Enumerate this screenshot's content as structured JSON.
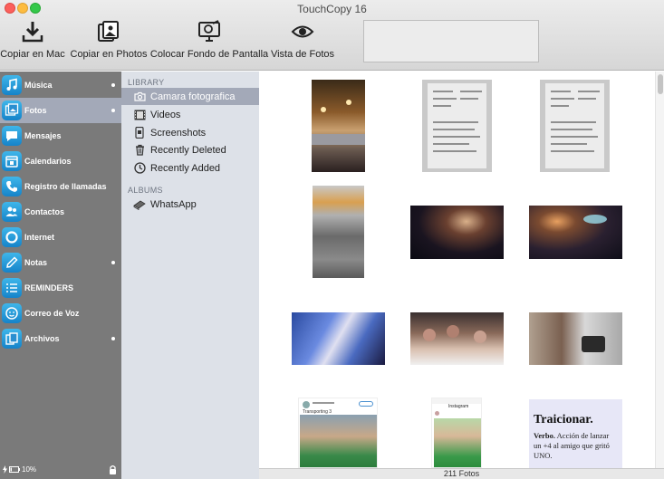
{
  "window": {
    "title": "TouchCopy 16"
  },
  "toolbar": {
    "buttons": [
      {
        "label": "Copiar en Mac",
        "icon": "download-icon"
      },
      {
        "label": "Copiar en Photos",
        "icon": "photos-stack-icon"
      },
      {
        "label": "Colocar Fondo de Pantalla",
        "icon": "monitor-wallpaper-icon"
      },
      {
        "label": "Vista de Fotos",
        "icon": "eye-icon"
      }
    ]
  },
  "sidebar": {
    "items": [
      {
        "label": "Música",
        "icon": "music-note-icon",
        "dot": true
      },
      {
        "label": "Fotos",
        "icon": "photos-icon",
        "dot": true,
        "active": true
      },
      {
        "label": "Mensajes",
        "icon": "chat-bubble-icon",
        "dot": false
      },
      {
        "label": "Calendarios",
        "icon": "calendar-icon",
        "dot": false
      },
      {
        "label": "Registro de llamadas",
        "icon": "phone-icon",
        "dot": false
      },
      {
        "label": "Contactos",
        "icon": "contacts-icon",
        "dot": false
      },
      {
        "label": "Internet",
        "icon": "internet-icon",
        "dot": false
      },
      {
        "label": "Notas",
        "icon": "pencil-icon",
        "dot": true
      },
      {
        "label": "REMINDERS",
        "icon": "list-icon",
        "dot": false
      },
      {
        "label": "Correo de Voz",
        "icon": "voicemail-icon",
        "dot": false
      },
      {
        "label": "Archivos",
        "icon": "files-icon",
        "dot": true
      }
    ],
    "battery": "10%"
  },
  "library": {
    "library_heading": "LIBRARY",
    "library_items": [
      {
        "label": "Camara fotografica",
        "icon": "camera-icon",
        "active": true
      },
      {
        "label": "Videos",
        "icon": "film-icon"
      },
      {
        "label": "Screenshots",
        "icon": "phone-screenshot-icon"
      },
      {
        "label": "Recently Deleted",
        "icon": "trash-icon"
      },
      {
        "label": "Recently Added",
        "icon": "clock-icon"
      }
    ],
    "albums_heading": "ALBUMS",
    "album_items": [
      {
        "label": "WhatsApp",
        "icon": "album-icon"
      }
    ]
  },
  "photos": {
    "card": {
      "title": "Traicionar.",
      "subtitle_bold": "Verbo.",
      "subtitle_rest": "Acción de lanzar un +4 al amigo que gritó UNO."
    },
    "social_top": "Transporting 3",
    "instagram_label": "Instagram"
  },
  "status": {
    "count": "211 Fotos"
  },
  "colors": {
    "sidebar_bg": "#7a7a7a",
    "sidebar_active": "#a3a9b8",
    "library_bg": "#dde1e8",
    "icon_blue": "#1e9ad9"
  }
}
